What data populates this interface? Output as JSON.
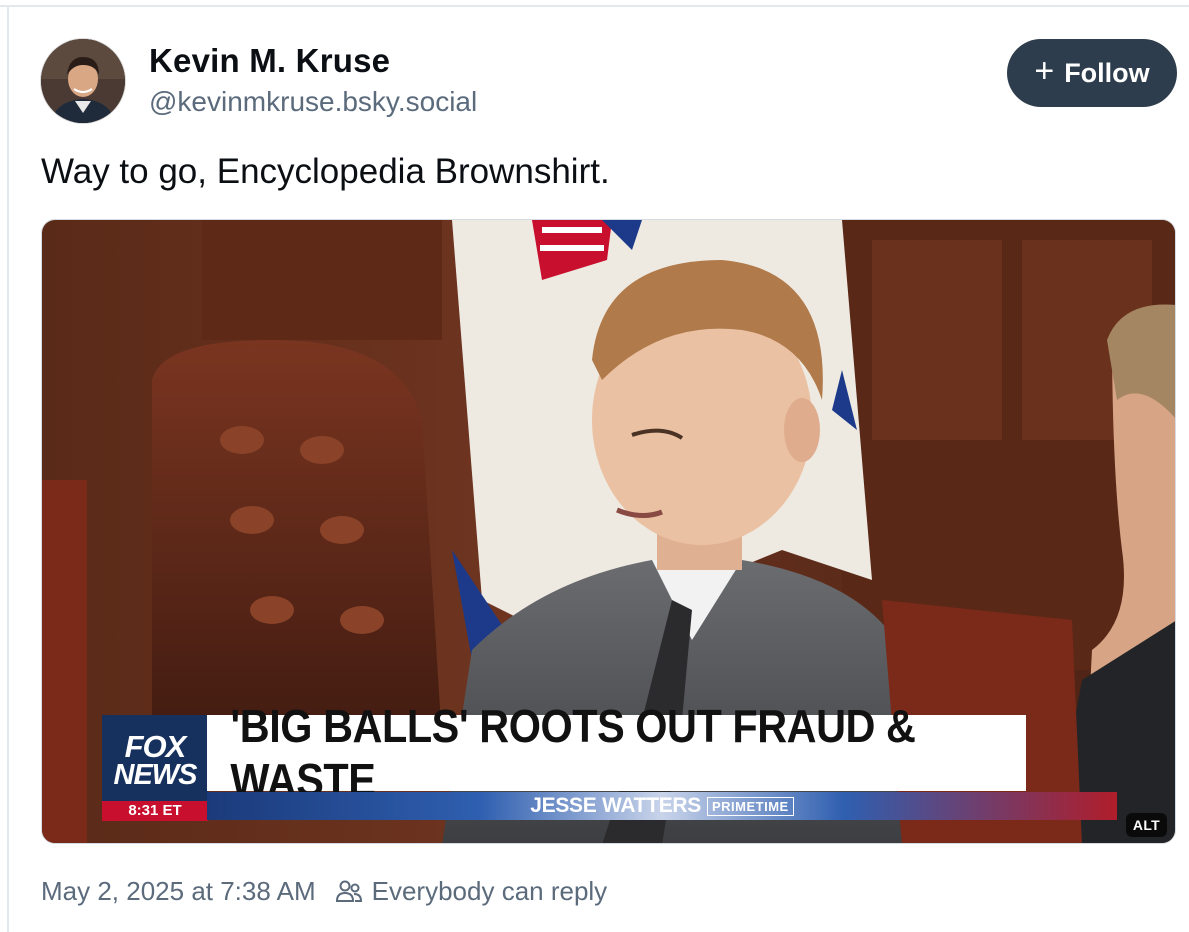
{
  "author": {
    "display_name": "Kevin M. Kruse",
    "handle": "@kevinmkruse.bsky.social"
  },
  "follow_button": {
    "label": "Follow",
    "icon": "plus-icon"
  },
  "post": {
    "text": "Way to go, Encyclopedia Brownshirt.",
    "media": {
      "chyron_headline": "'BIG BALLS' ROOTS OUT FRAUD & WASTE",
      "chyron_show": "JESSE WATTERS",
      "chyron_show_suffix": "PRIMETIME",
      "network_logo_top": "FOX",
      "network_logo_bottom": "NEWS",
      "network_time": "8:31 ET",
      "alt_badge": "ALT"
    }
  },
  "footer": {
    "timestamp": "May 2, 2025 at 7:38 AM",
    "reply_setting": "Everybody can reply",
    "reply_icon": "people-icon"
  },
  "colors": {
    "follow_bg": "#2e3d4d",
    "muted_text": "#5b6b7c",
    "primary_text": "#0b0f14"
  }
}
